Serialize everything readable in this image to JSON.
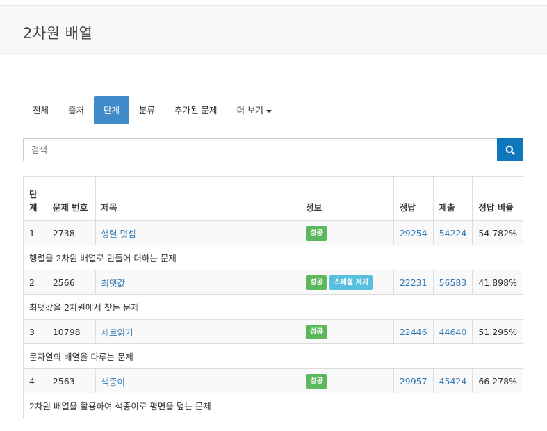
{
  "page": {
    "title": "2차원 배열"
  },
  "tabs": [
    {
      "label": "전체",
      "active": false
    },
    {
      "label": "출처",
      "active": false
    },
    {
      "label": "단계",
      "active": true
    },
    {
      "label": "분류",
      "active": false
    },
    {
      "label": "추가된 문제",
      "active": false
    },
    {
      "label": "더 보기",
      "active": false
    }
  ],
  "search": {
    "placeholder": "검색",
    "value": ""
  },
  "table": {
    "headers": {
      "level": "단계",
      "number": "문제 번호",
      "title": "제목",
      "info": "정보",
      "accepted": "정답",
      "submissions": "제출",
      "ratio": "정답 비율"
    },
    "rows": [
      {
        "level": "1",
        "number": "2738",
        "title": "행렬 덧셈",
        "badges": [
          "성공"
        ],
        "special": "",
        "accepted": "29254",
        "submissions": "54224",
        "ratio": "54.782%",
        "description": "행렬을 2차원 배열로 만들어 더하는 문제"
      },
      {
        "level": "2",
        "number": "2566",
        "title": "최댓값",
        "badges": [
          "성공"
        ],
        "special": "스페셜 저지",
        "accepted": "22231",
        "submissions": "56583",
        "ratio": "41.898%",
        "description": "최댓값을 2차원에서 찾는 문제"
      },
      {
        "level": "3",
        "number": "10798",
        "title": "세로읽기",
        "badges": [
          "성공"
        ],
        "special": "",
        "accepted": "22446",
        "submissions": "44640",
        "ratio": "51.295%",
        "description": "문자열의 배열을 다루는 문제"
      },
      {
        "level": "4",
        "number": "2563",
        "title": "색종이",
        "badges": [
          "성공"
        ],
        "special": "",
        "accepted": "29957",
        "submissions": "45424",
        "ratio": "66.278%",
        "description": "2차원 배열을 활용하여 색종이로 평면을 덮는 문제"
      }
    ]
  },
  "colors": {
    "accent": "#428bca",
    "search_button": "#0e76bc",
    "success": "#5cb85c",
    "info": "#5bc0de",
    "link": "#337ab7"
  },
  "icons": {
    "search": "search-icon",
    "dropdown": "caret-down-icon"
  }
}
